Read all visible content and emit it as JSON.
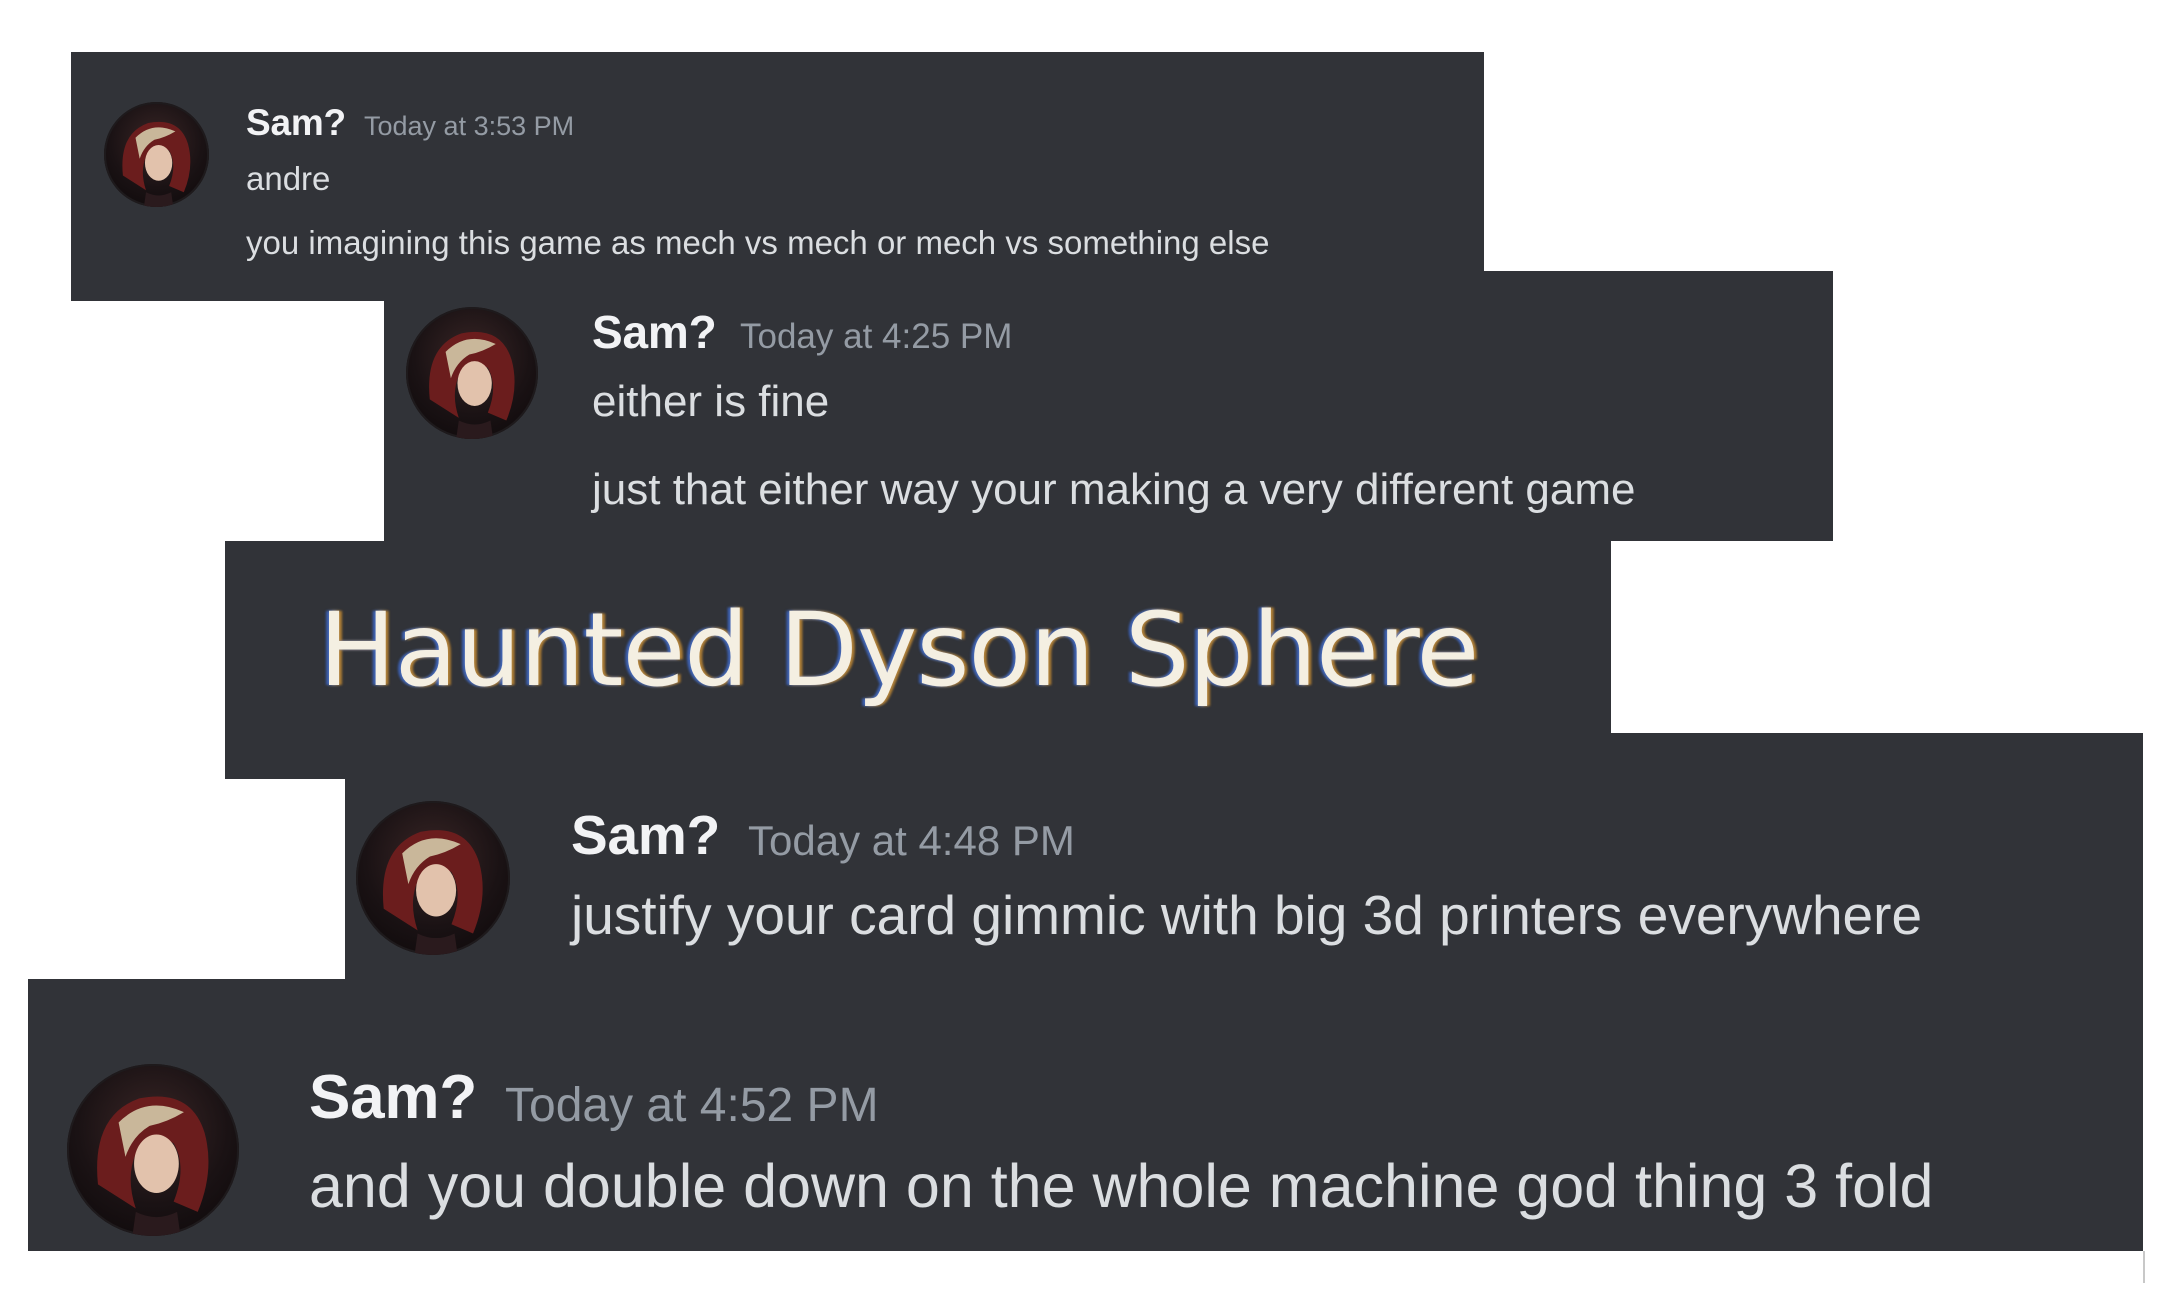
{
  "messages": [
    {
      "author": "Sam?",
      "timestamp": "Today at 3:53 PM",
      "lines": [
        "andre",
        "you imagining this game as mech vs mech or mech vs something else"
      ]
    },
    {
      "author": "Sam?",
      "timestamp": "Today at 4:25 PM",
      "lines": [
        "either is fine",
        "just that either way your making a very different game"
      ]
    },
    {
      "banner": "Haunted Dyson Sphere"
    },
    {
      "author": "Sam?",
      "timestamp": "Today at 4:48 PM",
      "lines": [
        "justify your card gimmic with big 3d printers everywhere"
      ]
    },
    {
      "author": "Sam?",
      "timestamp": "Today at 4:52 PM",
      "lines": [
        "and you double down on the whole machine god thing 3 fold"
      ]
    }
  ],
  "colors": {
    "panel_bg": "#313338",
    "username": "#f2f3f5",
    "timestamp": "#949ba4",
    "message_text": "#dbdee1",
    "page_bg": "#ffffff"
  },
  "icons": {
    "avatar": "user-avatar-icon"
  }
}
